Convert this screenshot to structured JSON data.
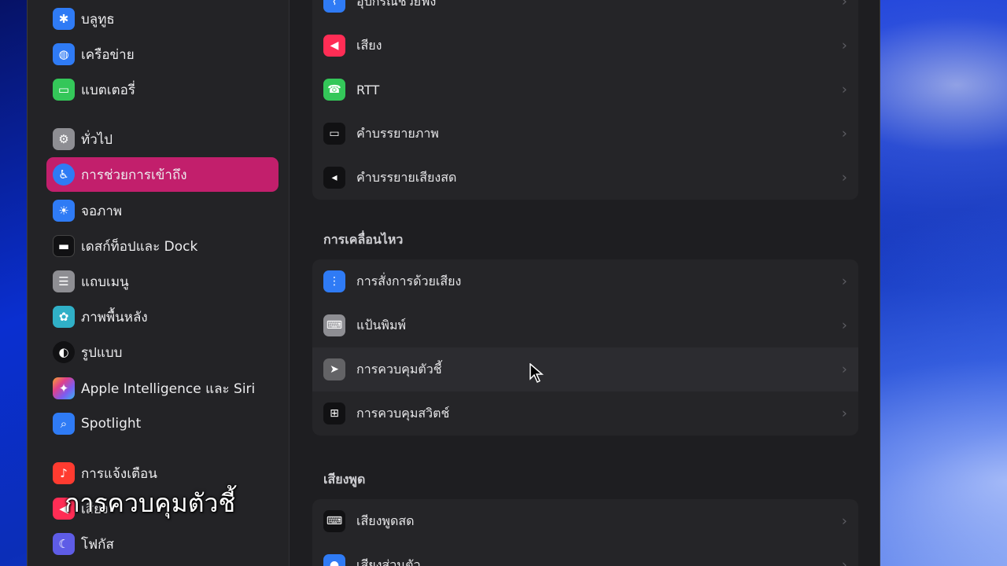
{
  "sidebar": {
    "items": [
      {
        "label": "บลูทูธ",
        "icon": "bluetooth-icon",
        "color": "#2f7bf5"
      },
      {
        "label": "เครือข่าย",
        "icon": "globe-icon",
        "color": "#2f7bf5"
      },
      {
        "label": "แบตเตอรี่",
        "icon": "battery-icon",
        "color": "#34c759"
      },
      {
        "label": "ทั่วไป",
        "icon": "gear-icon",
        "color": "#8e8e93"
      },
      {
        "label": "การช่วยการเข้าถึง",
        "icon": "accessibility-icon",
        "color": "#2f7bf5",
        "selected": true
      },
      {
        "label": "จอภาพ",
        "icon": "sun-icon",
        "color": "#2f7bf5"
      },
      {
        "label": "เดสก์ท็อปและ Dock",
        "icon": "dock-icon",
        "color": "#1c1c1e"
      },
      {
        "label": "แถบเมนู",
        "icon": "menubar-icon",
        "color": "#8e8e93"
      },
      {
        "label": "ภาพพื้นหลัง",
        "icon": "wallpaper-icon",
        "color": "#30b0c7"
      },
      {
        "label": "รูปแบบ",
        "icon": "appearance-icon",
        "color": "#1c1c1e"
      },
      {
        "label": "Apple Intelligence และ Siri",
        "icon": "siri-icon",
        "color": "#b05fe0"
      },
      {
        "label": "Spotlight",
        "icon": "search-icon",
        "color": "#2f7bf5"
      },
      {
        "label": "การแจ้งเตือน",
        "icon": "bell-icon",
        "color": "#ff3b30"
      },
      {
        "label": "เสียง",
        "icon": "speaker-icon",
        "color": "#ff2d55"
      },
      {
        "label": "โฟกัส",
        "icon": "moon-icon",
        "color": "#5e5ce6"
      }
    ]
  },
  "main": {
    "group1": [
      {
        "label": "อุปกรณ์ช่วยฟัง",
        "icon": "ear-icon",
        "color": "#2f7bf5"
      },
      {
        "label": "เสียง",
        "icon": "speaker-icon",
        "color": "#ff2d55"
      },
      {
        "label": "RTT",
        "icon": "tty-icon",
        "color": "#34c759"
      },
      {
        "label": "คำบรรยายภาพ",
        "icon": "caption-icon",
        "color": "#1c1c1e"
      },
      {
        "label": "คำบรรยายเสียงสด",
        "icon": "live-caption-icon",
        "color": "#1c1c1e"
      }
    ],
    "section2_title": "การเคลื่อนไหว",
    "group2": [
      {
        "label": "การสั่งการด้วยเสียง",
        "icon": "waveform-icon",
        "color": "#2f7bf5"
      },
      {
        "label": "แป้นพิมพ์",
        "icon": "keyboard-icon",
        "color": "#8e8e93"
      },
      {
        "label": "การควบคุมตัวชี้",
        "icon": "pointer-icon",
        "color": "#636366"
      },
      {
        "label": "การควบคุมสวิตช์",
        "icon": "grid-icon",
        "color": "#1c1c1e"
      }
    ],
    "section3_title": "เสียงพูด",
    "group3": [
      {
        "label": "เสียงพูดสด",
        "icon": "keyboard-icon",
        "color": "#1c1c1e"
      },
      {
        "label": "เสียงส่วนตัว",
        "icon": "person-icon",
        "color": "#2f7bf5"
      }
    ]
  },
  "caption": "การควบคุมตัวชี้"
}
